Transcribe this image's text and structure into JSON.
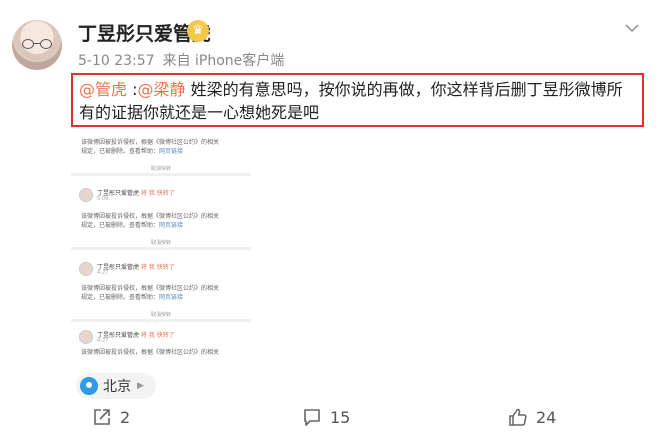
{
  "post": {
    "username": "丁昱彤只爱管虎",
    "badge_icon": "crown-icon",
    "time": "5-10 23:57",
    "source": "来自 iPhone客户端",
    "mention1": "@管虎",
    "mention_sep": " :",
    "mention2": "@梁静",
    "text": " 姓梁的有意思吗，按你说的再做，你这样背后删丁昱彤微博所有的证据你就还是一心想她死是吧",
    "highlight_color": "#e0332f",
    "mention_color": "#eb7350"
  },
  "screenshot": {
    "notices": [
      {
        "line1": "该微博因被投诉侵权，根据《微博社区公约》的相关",
        "line2": "规定，已被删除。查看帮助：",
        "link": "网页链接",
        "forward": "取消快转"
      },
      {
        "line1": "该微博因被投诉侵权，根据《微博社区公约》的相关",
        "line2": "规定，已被删除。查看帮助：",
        "link": "网页链接",
        "forward": "取消快转"
      },
      {
        "line1": "该微博因被投诉侵权，根据《微博社区公约》的相关",
        "line2": "规定，已被删除。查看帮助：",
        "link": "网页链接",
        "forward": "取消快转"
      },
      {
        "line1": "该微博因被投诉侵权，根据《微博社区公约》的相关",
        "line2": "",
        "link": "",
        "forward": ""
      }
    ],
    "heads": [
      {
        "name": "丁昱彤只爱管虎",
        "action": "将 我 快转了",
        "time": "5-09"
      },
      {
        "name": "丁昱彤只爱管虎",
        "action": "将 我 快转了",
        "time": "4-27"
      },
      {
        "name": "丁昱彤只爱管虎",
        "action": "将 我 快转了",
        "time": "4-27"
      }
    ]
  },
  "location": {
    "text": "北京",
    "icon": "location-pin-icon"
  },
  "actions": {
    "forward_count": "2",
    "comment_count": "15",
    "like_count": "24"
  }
}
